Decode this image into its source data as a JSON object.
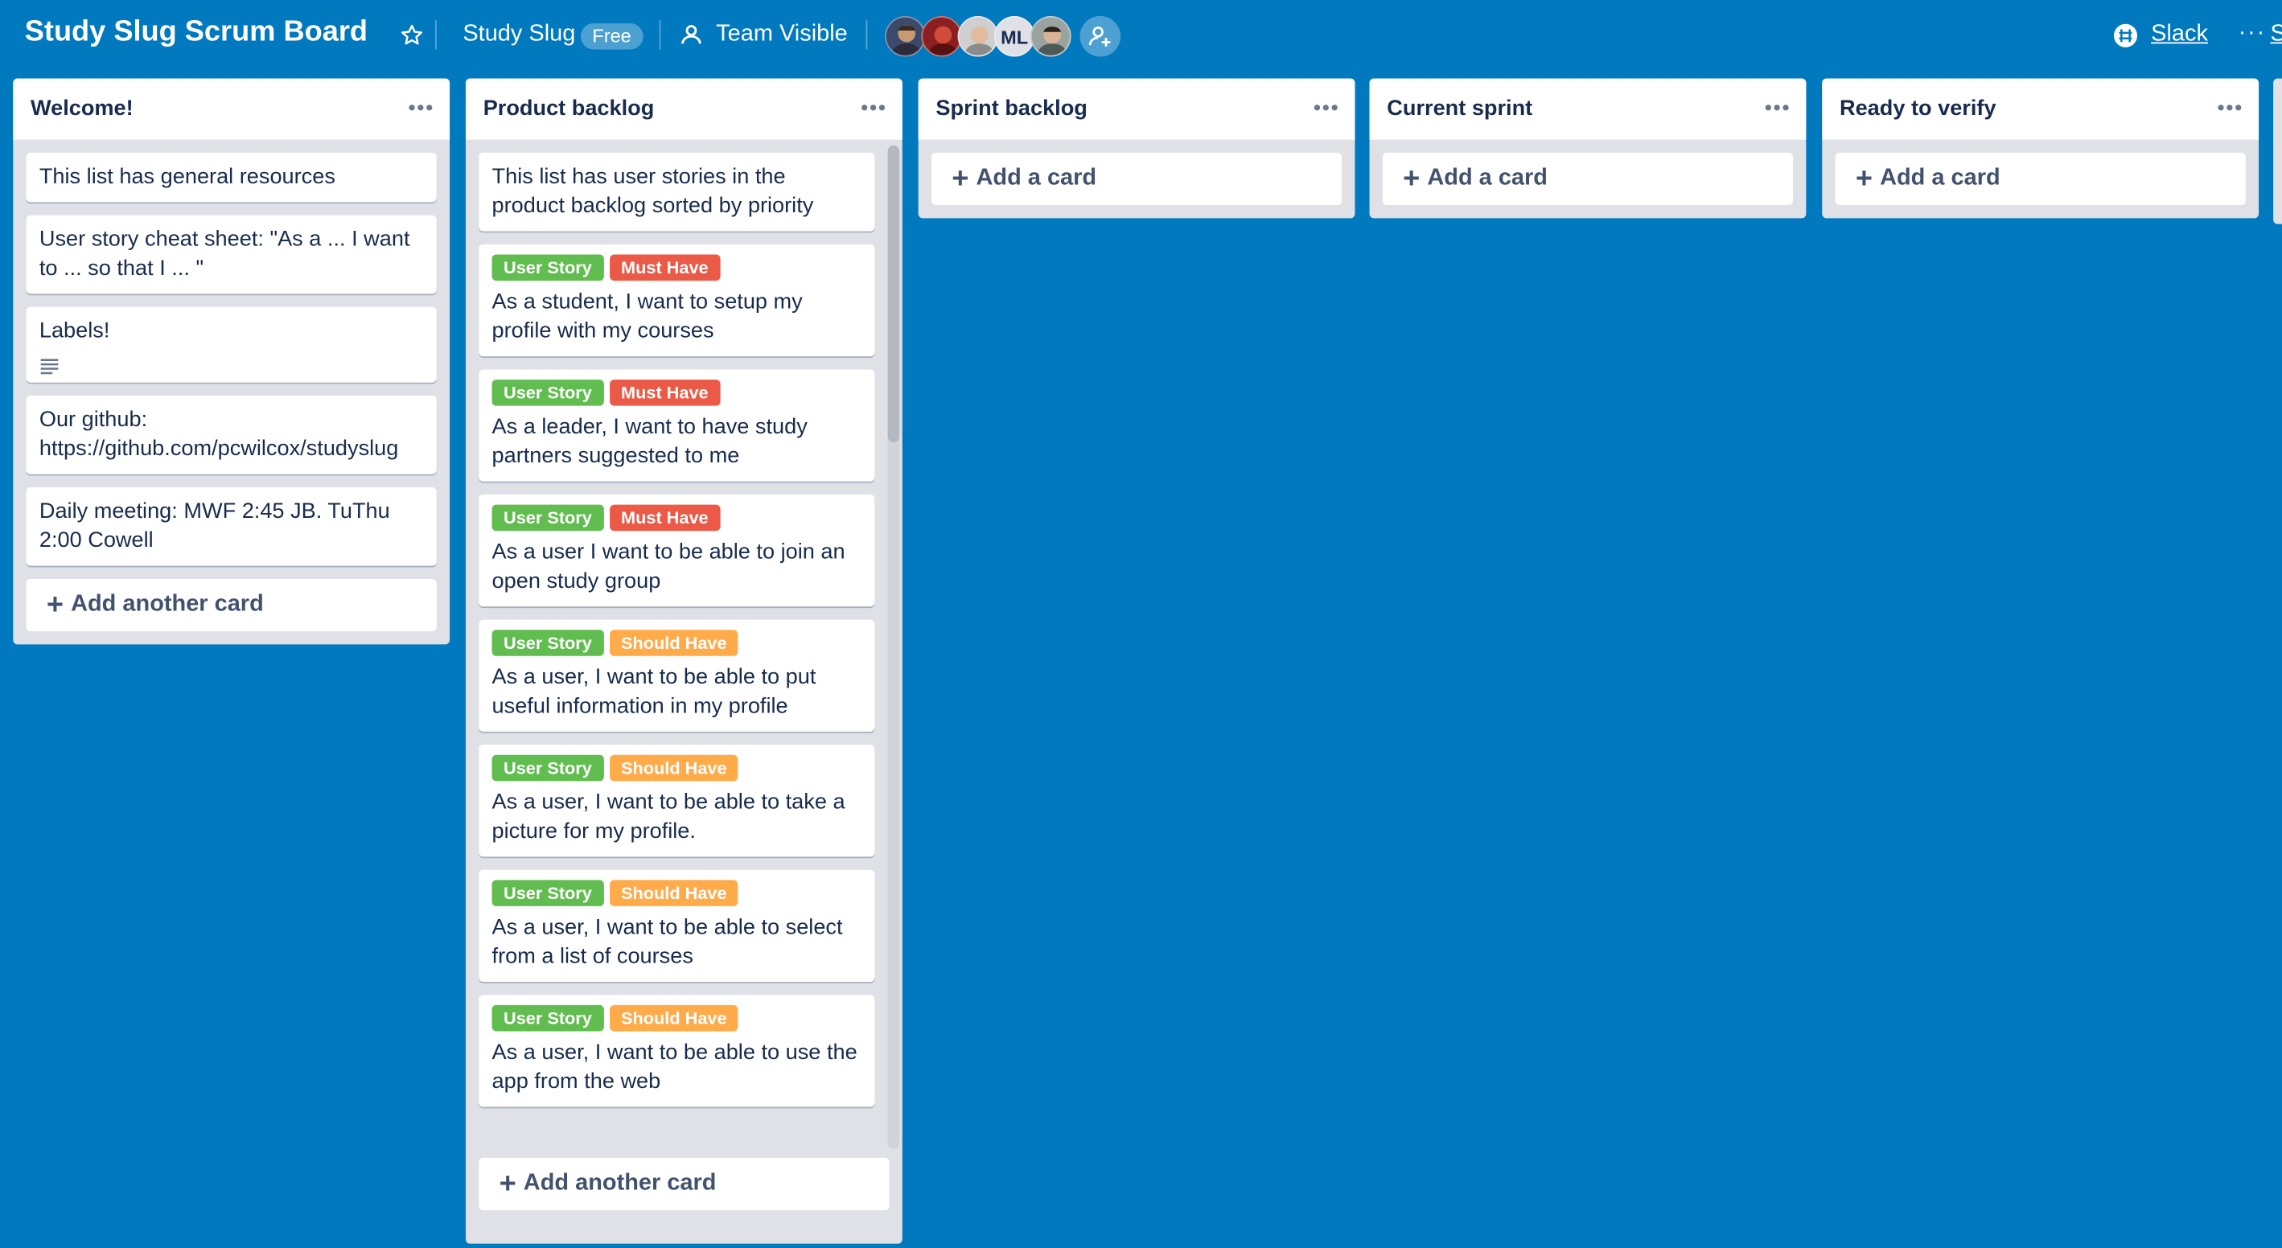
{
  "header": {
    "board_title": "Study Slug Scrum Board",
    "team_name": "Study Slug",
    "team_badge": "Free",
    "visibility": "Team Visible",
    "members": [
      "member-avatar",
      "member-avatar",
      "member-avatar",
      "ML",
      "member-avatar"
    ],
    "slack_label": "Slack",
    "more_label": "···",
    "show_menu_label": "S"
  },
  "colors": {
    "board_bg": "#0079bf",
    "list_bg": "#dfe1e6",
    "label_green": "#61bd4f",
    "label_red": "#eb5a46",
    "label_orange": "#ffab4a"
  },
  "lists": [
    {
      "title": "Welcome!",
      "cards": [
        {
          "text": "This list has general resources"
        },
        {
          "text": "User story cheat sheet: \"As a ... I want to ... so that I ... \""
        },
        {
          "text": "Labels!",
          "has_description": true
        },
        {
          "text": "Our github: https://github.com/pcwilcox/studyslug"
        },
        {
          "text": "Daily meeting: MWF 2:45 JB. TuThu 2:00 Cowell"
        }
      ],
      "add_label": "Add another card"
    },
    {
      "title": "Product backlog",
      "cards": [
        {
          "text": "This list has user stories in the product backlog sorted by priority"
        },
        {
          "labels": [
            "User Story",
            "Must Have"
          ],
          "text": "As a student, I want to setup my profile with my courses"
        },
        {
          "labels": [
            "User Story",
            "Must Have"
          ],
          "text": "As a leader, I want to have study partners suggested to me"
        },
        {
          "labels": [
            "User Story",
            "Must Have"
          ],
          "text": "As a user I want to be able to join an open study group"
        },
        {
          "labels": [
            "User Story",
            "Should Have"
          ],
          "text": "As a user, I want to be able to put useful information in my profile"
        },
        {
          "labels": [
            "User Story",
            "Should Have"
          ],
          "text": "As a user, I want to be able to take a picture for my profile."
        },
        {
          "labels": [
            "User Story",
            "Should Have"
          ],
          "text": "As a user, I want to be able to select from a list of courses"
        },
        {
          "labels": [
            "User Story",
            "Should Have"
          ],
          "text": "As a user, I want to be able to use the app from the web"
        }
      ],
      "add_label": "Add another card"
    },
    {
      "title": "Sprint backlog",
      "cards": [],
      "add_label": "Add a card"
    },
    {
      "title": "Current sprint",
      "cards": [],
      "add_label": "Add a card"
    },
    {
      "title": "Ready to verify",
      "cards": [],
      "add_label": "Add a card"
    }
  ]
}
